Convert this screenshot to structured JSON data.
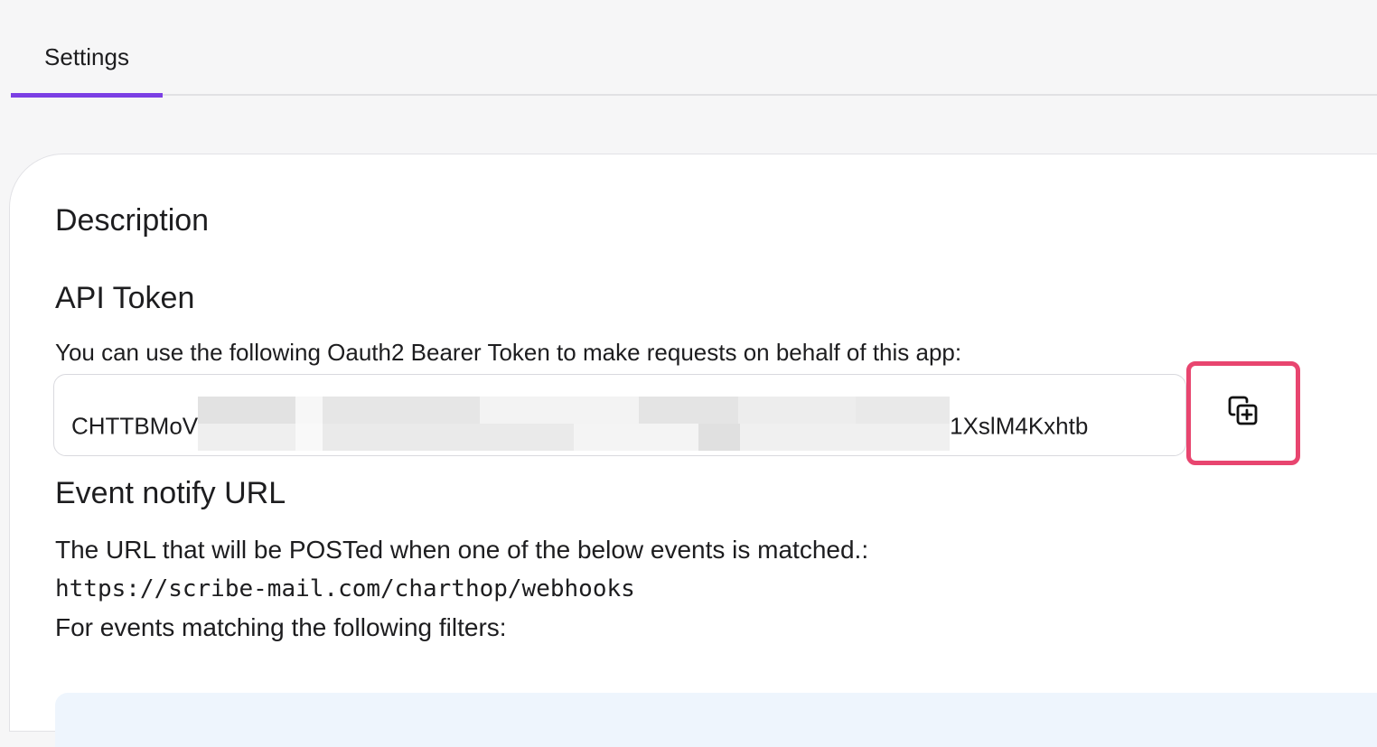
{
  "tabs": [
    {
      "label": "Settings",
      "active": true
    }
  ],
  "card": {
    "description_title": "Description",
    "api_token": {
      "title": "API Token",
      "helper": "You can use the following Oauth2 Bearer Token to make requests on behalf of this app:",
      "token_start": "CHTTBMoV",
      "token_end": "1XslM4Kxhtb",
      "copy_icon": "copy-icon"
    },
    "event_notify": {
      "title": "Event notify URL",
      "description": "The URL that will be POSTed when one of the below events is matched.:",
      "url": "https://scribe-mail.com/charthop/webhooks",
      "filters_text": "For events matching the following filters:"
    }
  },
  "colors": {
    "accent": "#7b3fe4",
    "highlight": "#e8456f",
    "background": "#f6f6f7",
    "filter_box": "#eef5fd"
  }
}
